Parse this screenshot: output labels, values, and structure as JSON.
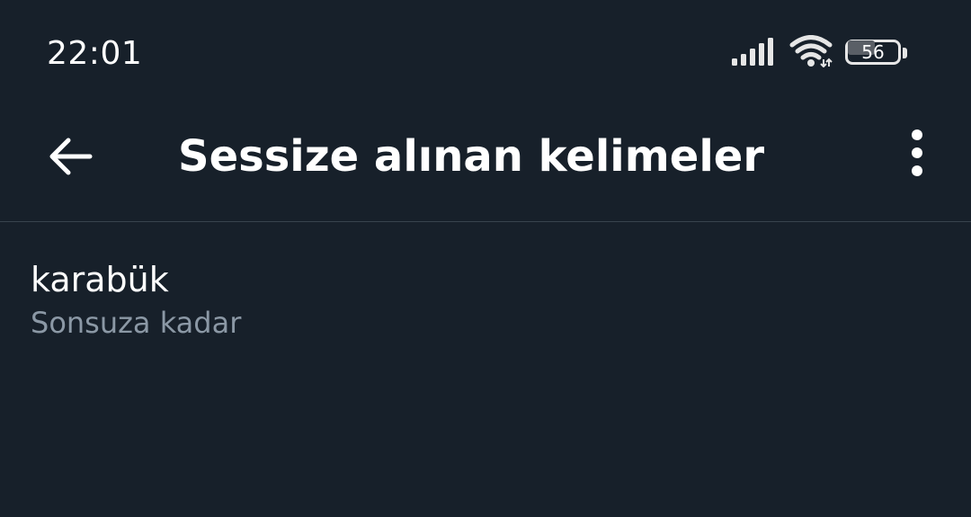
{
  "status_bar": {
    "time": "22:01",
    "battery_level": "56",
    "icons": [
      "signal-icon",
      "wifi-icon",
      "battery-icon"
    ]
  },
  "app_bar": {
    "back_icon": "arrow-left-icon",
    "title": "Sessize alınan kelimeler",
    "more_icon": "more-vertical-icon"
  },
  "muted_words": [
    {
      "word": "karabük",
      "duration": "Sonsuza kadar"
    }
  ],
  "colors": {
    "background": "#17202a",
    "text_primary": "#ffffff",
    "text_secondary": "#8b98a5",
    "divider": "#38444d"
  }
}
